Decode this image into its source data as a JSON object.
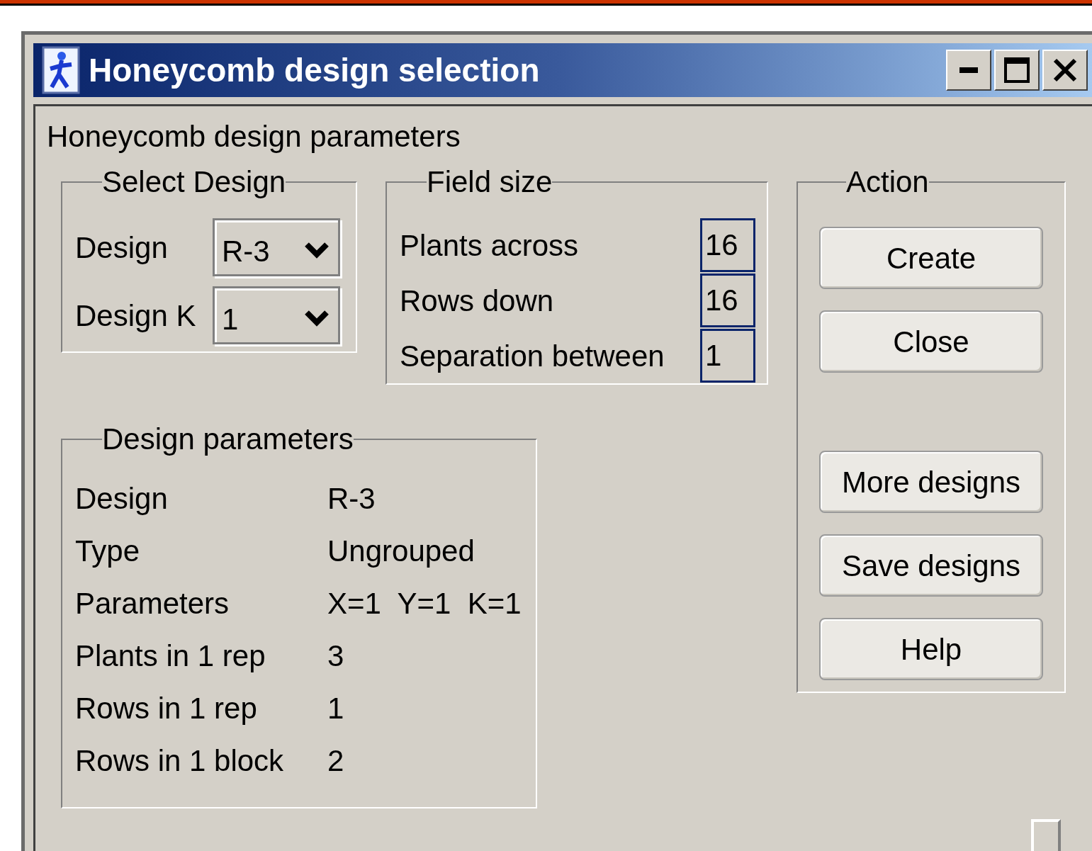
{
  "window": {
    "title": "Honeycomb design selection"
  },
  "heading": "Honeycomb design parameters",
  "select_design": {
    "title": "Select Design",
    "fields": [
      {
        "label": "Design",
        "value": "R-3"
      },
      {
        "label": "Design K",
        "value": "1"
      }
    ]
  },
  "field_size": {
    "title": "Field size",
    "fields": [
      {
        "label": "Plants across",
        "value": "16"
      },
      {
        "label": "Rows down",
        "value": "16"
      },
      {
        "label": "Separation between",
        "value": "1"
      }
    ]
  },
  "action": {
    "title": "Action",
    "buttons_top": [
      "Create",
      "Close"
    ],
    "buttons_bottom": [
      "More designs",
      "Save designs",
      "Help"
    ]
  },
  "design_parameters": {
    "title": "Design parameters",
    "rows": [
      {
        "label": "Design",
        "value": "R-3"
      },
      {
        "label": "Type",
        "value": "Ungrouped"
      },
      {
        "label": "Parameters",
        "value": "X=1  Y=1  K=1"
      },
      {
        "label": "Plants in 1 rep",
        "value": "3"
      },
      {
        "label": "Rows in 1 rep",
        "value": "1"
      },
      {
        "label": "Rows in 1 block",
        "value": "2"
      }
    ]
  }
}
